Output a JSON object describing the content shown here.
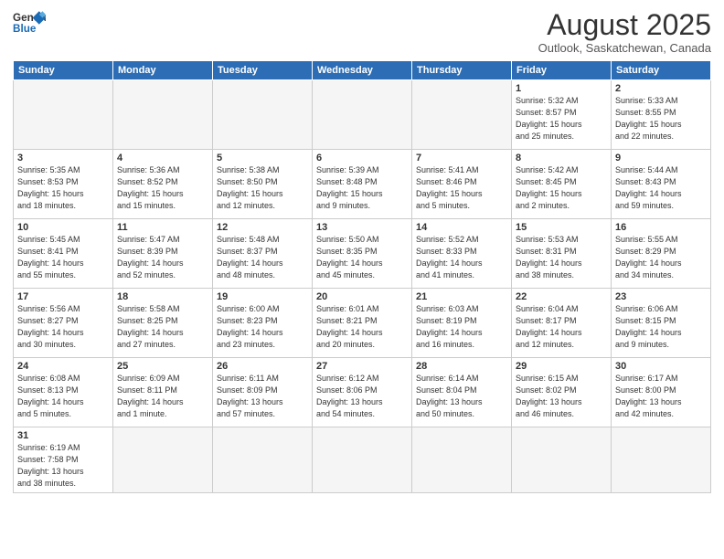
{
  "header": {
    "logo_general": "General",
    "logo_blue": "Blue",
    "month_title": "August 2025",
    "subtitle": "Outlook, Saskatchewan, Canada"
  },
  "weekdays": [
    "Sunday",
    "Monday",
    "Tuesday",
    "Wednesday",
    "Thursday",
    "Friday",
    "Saturday"
  ],
  "weeks": [
    [
      {
        "day": "",
        "info": ""
      },
      {
        "day": "",
        "info": ""
      },
      {
        "day": "",
        "info": ""
      },
      {
        "day": "",
        "info": ""
      },
      {
        "day": "",
        "info": ""
      },
      {
        "day": "1",
        "info": "Sunrise: 5:32 AM\nSunset: 8:57 PM\nDaylight: 15 hours\nand 25 minutes."
      },
      {
        "day": "2",
        "info": "Sunrise: 5:33 AM\nSunset: 8:55 PM\nDaylight: 15 hours\nand 22 minutes."
      }
    ],
    [
      {
        "day": "3",
        "info": "Sunrise: 5:35 AM\nSunset: 8:53 PM\nDaylight: 15 hours\nand 18 minutes."
      },
      {
        "day": "4",
        "info": "Sunrise: 5:36 AM\nSunset: 8:52 PM\nDaylight: 15 hours\nand 15 minutes."
      },
      {
        "day": "5",
        "info": "Sunrise: 5:38 AM\nSunset: 8:50 PM\nDaylight: 15 hours\nand 12 minutes."
      },
      {
        "day": "6",
        "info": "Sunrise: 5:39 AM\nSunset: 8:48 PM\nDaylight: 15 hours\nand 9 minutes."
      },
      {
        "day": "7",
        "info": "Sunrise: 5:41 AM\nSunset: 8:46 PM\nDaylight: 15 hours\nand 5 minutes."
      },
      {
        "day": "8",
        "info": "Sunrise: 5:42 AM\nSunset: 8:45 PM\nDaylight: 15 hours\nand 2 minutes."
      },
      {
        "day": "9",
        "info": "Sunrise: 5:44 AM\nSunset: 8:43 PM\nDaylight: 14 hours\nand 59 minutes."
      }
    ],
    [
      {
        "day": "10",
        "info": "Sunrise: 5:45 AM\nSunset: 8:41 PM\nDaylight: 14 hours\nand 55 minutes."
      },
      {
        "day": "11",
        "info": "Sunrise: 5:47 AM\nSunset: 8:39 PM\nDaylight: 14 hours\nand 52 minutes."
      },
      {
        "day": "12",
        "info": "Sunrise: 5:48 AM\nSunset: 8:37 PM\nDaylight: 14 hours\nand 48 minutes."
      },
      {
        "day": "13",
        "info": "Sunrise: 5:50 AM\nSunset: 8:35 PM\nDaylight: 14 hours\nand 45 minutes."
      },
      {
        "day": "14",
        "info": "Sunrise: 5:52 AM\nSunset: 8:33 PM\nDaylight: 14 hours\nand 41 minutes."
      },
      {
        "day": "15",
        "info": "Sunrise: 5:53 AM\nSunset: 8:31 PM\nDaylight: 14 hours\nand 38 minutes."
      },
      {
        "day": "16",
        "info": "Sunrise: 5:55 AM\nSunset: 8:29 PM\nDaylight: 14 hours\nand 34 minutes."
      }
    ],
    [
      {
        "day": "17",
        "info": "Sunrise: 5:56 AM\nSunset: 8:27 PM\nDaylight: 14 hours\nand 30 minutes."
      },
      {
        "day": "18",
        "info": "Sunrise: 5:58 AM\nSunset: 8:25 PM\nDaylight: 14 hours\nand 27 minutes."
      },
      {
        "day": "19",
        "info": "Sunrise: 6:00 AM\nSunset: 8:23 PM\nDaylight: 14 hours\nand 23 minutes."
      },
      {
        "day": "20",
        "info": "Sunrise: 6:01 AM\nSunset: 8:21 PM\nDaylight: 14 hours\nand 20 minutes."
      },
      {
        "day": "21",
        "info": "Sunrise: 6:03 AM\nSunset: 8:19 PM\nDaylight: 14 hours\nand 16 minutes."
      },
      {
        "day": "22",
        "info": "Sunrise: 6:04 AM\nSunset: 8:17 PM\nDaylight: 14 hours\nand 12 minutes."
      },
      {
        "day": "23",
        "info": "Sunrise: 6:06 AM\nSunset: 8:15 PM\nDaylight: 14 hours\nand 9 minutes."
      }
    ],
    [
      {
        "day": "24",
        "info": "Sunrise: 6:08 AM\nSunset: 8:13 PM\nDaylight: 14 hours\nand 5 minutes."
      },
      {
        "day": "25",
        "info": "Sunrise: 6:09 AM\nSunset: 8:11 PM\nDaylight: 14 hours\nand 1 minute."
      },
      {
        "day": "26",
        "info": "Sunrise: 6:11 AM\nSunset: 8:09 PM\nDaylight: 13 hours\nand 57 minutes."
      },
      {
        "day": "27",
        "info": "Sunrise: 6:12 AM\nSunset: 8:06 PM\nDaylight: 13 hours\nand 54 minutes."
      },
      {
        "day": "28",
        "info": "Sunrise: 6:14 AM\nSunset: 8:04 PM\nDaylight: 13 hours\nand 50 minutes."
      },
      {
        "day": "29",
        "info": "Sunrise: 6:15 AM\nSunset: 8:02 PM\nDaylight: 13 hours\nand 46 minutes."
      },
      {
        "day": "30",
        "info": "Sunrise: 6:17 AM\nSunset: 8:00 PM\nDaylight: 13 hours\nand 42 minutes."
      }
    ],
    [
      {
        "day": "31",
        "info": "Sunrise: 6:19 AM\nSunset: 7:58 PM\nDaylight: 13 hours\nand 38 minutes."
      },
      {
        "day": "",
        "info": ""
      },
      {
        "day": "",
        "info": ""
      },
      {
        "day": "",
        "info": ""
      },
      {
        "day": "",
        "info": ""
      },
      {
        "day": "",
        "info": ""
      },
      {
        "day": "",
        "info": ""
      }
    ]
  ]
}
